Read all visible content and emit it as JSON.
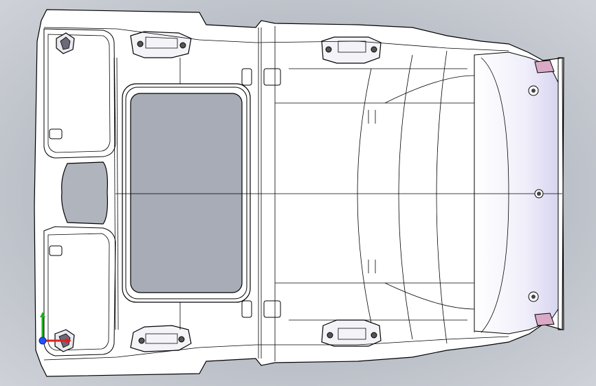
{
  "viewport": {
    "background_top": "#d2d5db",
    "background_bottom": "#9aa0ab",
    "model_face_color": "#ffffff",
    "model_shade_color": "#e4e2f4",
    "edge_color": "#000000",
    "accent_pink": "#d9a9c6"
  },
  "model": {
    "name": "roof-headliner-part",
    "view": "top"
  },
  "triad": {
    "x_color": "#e02020",
    "y_color": "#20b020",
    "z_color": "#2050ff"
  }
}
